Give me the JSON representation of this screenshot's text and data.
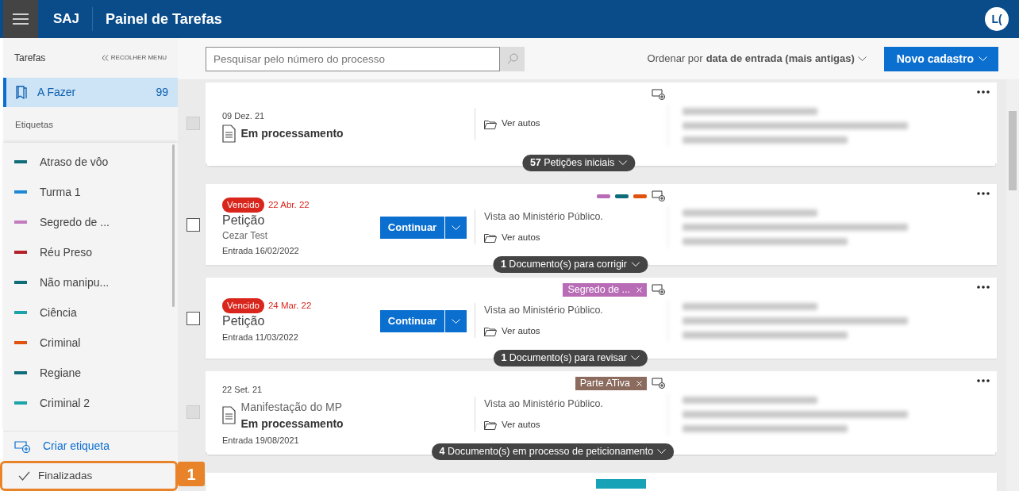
{
  "header": {
    "brand": "SAJ",
    "title": "Painel de Tarefas",
    "avatar": "L("
  },
  "sidebar": {
    "heading": "Tarefas",
    "collapse": "RECOLHER MENU",
    "inbox": {
      "label": "A Fazer",
      "count": "99",
      "selected": true
    },
    "labels_heading": "Etiquetas",
    "labels": [
      {
        "name": "Atraso de vôo",
        "color": "#0e6d78"
      },
      {
        "name": "Turma 1",
        "color": "#1e88d6"
      },
      {
        "name": "Segredo de ...",
        "color": "#c17bbf"
      },
      {
        "name": "Réu Preso",
        "color": "#b3202b"
      },
      {
        "name": "Não manipu...",
        "color": "#0e6d78"
      },
      {
        "name": "Ciência",
        "color": "#1aa3a8"
      },
      {
        "name": "Criminal",
        "color": "#e0520f"
      },
      {
        "name": "Regiane",
        "color": "#0e6d78"
      },
      {
        "name": "Criminal 2",
        "color": "#1aa3a8"
      }
    ],
    "create": "Criar etiqueta",
    "finished": {
      "label": "Finalizadas",
      "selected": false
    },
    "callout": "1"
  },
  "toolbar": {
    "search": {
      "placeholder": "Pesquisar pelo número do processo"
    },
    "sort_prefix": "Ordenar por",
    "sort_value": "data de entrada (mais antigas)",
    "new_button": "Novo cadastro"
  },
  "cards": [
    {
      "kind": "processing",
      "checkbox": {
        "checked": false,
        "disabled": true
      },
      "date": "09 Dez. 21",
      "status": "Em processamento",
      "link": "Ver autos",
      "stacked": true,
      "pill": "**57** Petições iniciais"
    },
    {
      "kind": "task",
      "checkbox": {
        "checked": false,
        "disabled": false
      },
      "badge": "Vencido",
      "date": "22 Abr. 22",
      "title": "Petição",
      "subtitle": "Cezar Test",
      "entry": "Entrada 16/02/2022",
      "action": "Continuar",
      "note": "Vista ao Ministério Público.",
      "link": "Ver autos",
      "color_tags": [
        {
          "color": "#b86cb6"
        },
        {
          "color": "#0e6d78"
        },
        {
          "color": "#e0520f"
        }
      ],
      "stacked": false,
      "pill": "**1** Documento(s) para corrigir"
    },
    {
      "kind": "task",
      "checkbox": {
        "checked": false,
        "disabled": false
      },
      "badge": "Vencido",
      "date": "24 Mar. 22",
      "title": "Petição",
      "entry": "Entrada 11/03/2022",
      "action": "Continuar",
      "note": "Vista ao Ministério Público.",
      "link": "Ver autos",
      "tags": [
        {
          "label": "Segredo de ...",
          "color": "#b86cb6"
        }
      ],
      "stacked": false,
      "pill": "**1** Documento(s) para revisar"
    },
    {
      "kind": "processing",
      "checkbox": {
        "checked": false,
        "disabled": true
      },
      "date": "22 Set. 21",
      "title": "Manifestação do MP",
      "status": "Em processamento",
      "entry": "Entrada 19/08/2021",
      "note": "Vista ao Ministério Público.",
      "link": "Ver autos",
      "tags": [
        {
          "label": "Parte ATiva",
          "color": "#8b6b5e"
        }
      ],
      "stacked": true,
      "pill": "**4** Documento(s) em processo de peticionamento"
    },
    {
      "kind": "partial",
      "tags": [
        {
          "color": "#17a2b8"
        }
      ]
    }
  ]
}
